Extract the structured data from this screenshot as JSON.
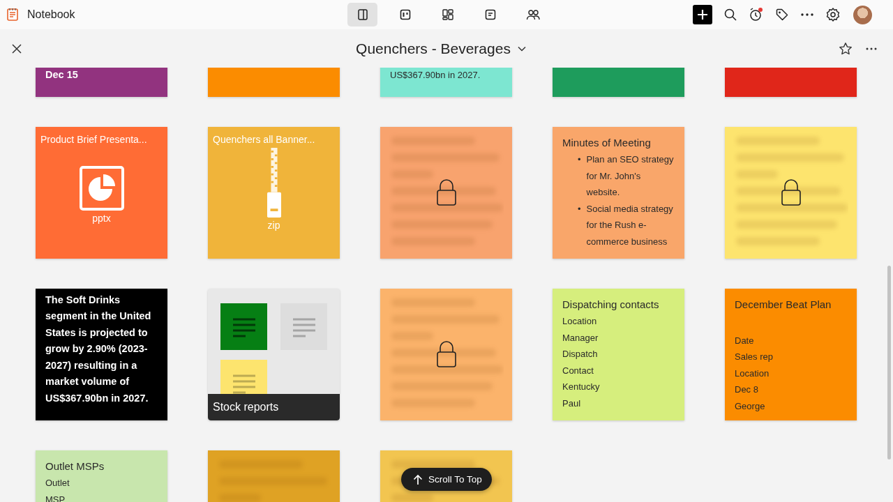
{
  "app": {
    "name": "Notebook"
  },
  "views": [
    {
      "kind": "single",
      "selected": true
    },
    {
      "kind": "board",
      "selected": false
    },
    {
      "kind": "grid",
      "selected": false
    },
    {
      "kind": "note",
      "selected": false
    },
    {
      "kind": "shared",
      "selected": false
    }
  ],
  "reminder": {
    "unread": true
  },
  "notebook": {
    "title": "Quenchers - Beverages"
  },
  "cards": [
    {
      "kind": "text",
      "color": "#92337f",
      "lines": [
        "Dec 15"
      ]
    },
    {
      "kind": "blank",
      "color": "#fb8c00"
    },
    {
      "kind": "text",
      "color": "#7de6d1",
      "lines": [
        "US$367.90bn in 2027."
      ]
    },
    {
      "kind": "blank",
      "color": "#1e9c5c"
    },
    {
      "kind": "blank",
      "color": "#e0261a"
    },
    {
      "kind": "file",
      "color": "#ff6c35",
      "title": "Product Brief Presenta...",
      "file_type": "pptx"
    },
    {
      "kind": "file",
      "color": "#f0b43a",
      "title": "Quenchers all Banner...",
      "file_type": "zip"
    },
    {
      "kind": "locked",
      "color": "#f8a36e"
    },
    {
      "kind": "bullets",
      "color": "#f9a66a",
      "title": "Minutes of Meeting",
      "items": [
        {
          "marker": "•",
          "text": "Plan an SEO strategy for Mr. John's website."
        },
        {
          "marker": "•",
          "text": "Social media strategy for the Rush e-commerce business"
        }
      ]
    },
    {
      "kind": "locked",
      "color": "#fde46e"
    },
    {
      "kind": "text",
      "color": "#000000",
      "lines": [
        "The Soft Drinks segment in the United States is projected to grow by 2.90% (2023-2027) resulting in a market volume of US$367.90bn in 2027."
      ]
    },
    {
      "kind": "folder",
      "color": "#e8e8e8",
      "title": "Stock reports",
      "thumbnails": [
        {
          "color": "#067f14"
        },
        {
          "color": "#dddddd"
        },
        {
          "color": "#fde46e"
        }
      ]
    },
    {
      "kind": "locked",
      "color": "#fbb36b"
    },
    {
      "kind": "list",
      "color": "#d6ee7d",
      "title": "Dispatching contacts",
      "spaced": false,
      "items": [
        "Location",
        "Manager",
        "Dispatch",
        "Contact",
        "Kentucky",
        "Paul"
      ]
    },
    {
      "kind": "list",
      "color": "#fb8c00",
      "title": "December Beat Plan",
      "spaced": true,
      "items": [
        "Date",
        "Sales rep",
        "Location",
        "Dec 8",
        "George"
      ]
    },
    {
      "kind": "list",
      "color": "#c8e6ad",
      "title": "Outlet MSPs",
      "spaced": false,
      "items": [
        "Outlet",
        "MSP"
      ]
    },
    {
      "kind": "locked",
      "color": "#dfa224"
    },
    {
      "kind": "locked",
      "color": "#f2c550"
    }
  ],
  "scroll_button": {
    "label": "Scroll To Top"
  }
}
